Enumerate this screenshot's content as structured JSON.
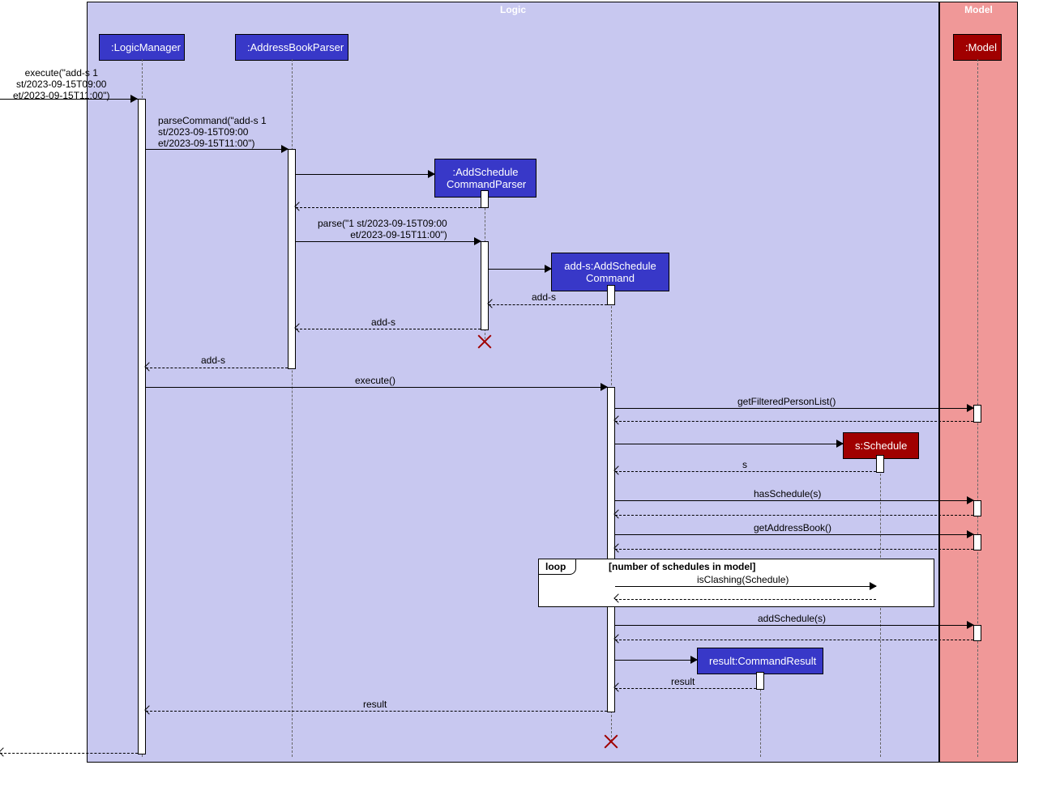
{
  "frames": {
    "logic": "Logic",
    "model": "Model"
  },
  "participants": {
    "logicManager": ":LogicManager",
    "addressBookParser": ":AddressBookParser",
    "addScheduleCommandParser": ":AddSchedule\nCommandParser",
    "addScheduleCommand": "add-s:AddSchedule\nCommand",
    "schedule": "s:Schedule",
    "commandResult": "result:CommandResult",
    "model": ":Model"
  },
  "messages": {
    "execute1": "execute(\"add-s 1\nst/2023-09-15T09:00\net/2023-09-15T11:00\")",
    "parseCommand": "parseCommand(\"add-s 1\nst/2023-09-15T09:00\net/2023-09-15T11:00\")",
    "parse": "parse(\"1 st/2023-09-15T09:00\net/2023-09-15T11:00\")",
    "addS1": "add-s",
    "addS2": "add-s",
    "addS3": "add-s",
    "execute2": "execute()",
    "getFilteredPersonList": "getFilteredPersonList()",
    "returnS": "s",
    "hasSchedule": "hasSchedule(s)",
    "getAddressBook": "getAddressBook()",
    "isClashing": "isClashing(Schedule)",
    "addSchedule": "addSchedule(s)",
    "returnResult": "result",
    "result2": "result"
  },
  "loop": {
    "label": "loop",
    "condition": "[number of schedules in model]"
  }
}
